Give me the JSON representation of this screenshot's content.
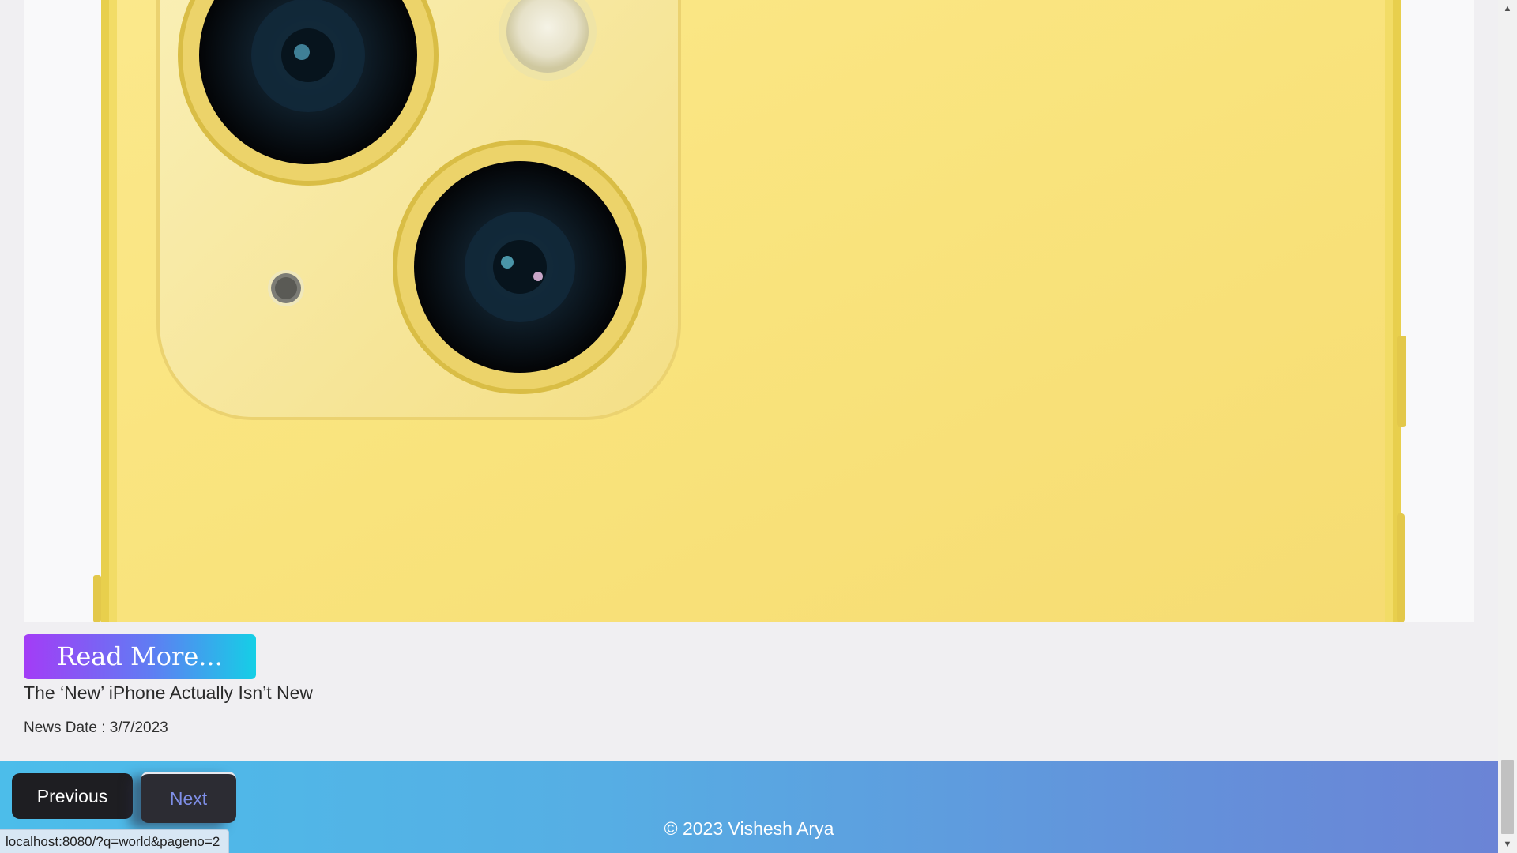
{
  "article": {
    "image_alt": "Yellow iPhone rear camera close-up",
    "read_more_label": "Read More...",
    "headline": "The ‘New’ iPhone Actually Isn’t New",
    "date_label": "News Date : 3/7/2023"
  },
  "pagination": {
    "previous_label": "Previous",
    "next_label": "Next"
  },
  "footer": {
    "copyright": "© 2023 Vishesh Arya"
  },
  "status_bar": {
    "url": "localhost:8080/?q=world&pageno=2"
  },
  "scrollbar": {
    "up_glyph": "▲",
    "down_glyph": "▼",
    "position_fraction": 1.0
  },
  "colors": {
    "read_more_gradient": [
      "#a33cf6",
      "#15cfe6"
    ],
    "footer_gradient": [
      "#4cbdea",
      "#6b84d6"
    ],
    "phone_body": "#f7e37e",
    "page_background": "#f0eff2"
  }
}
